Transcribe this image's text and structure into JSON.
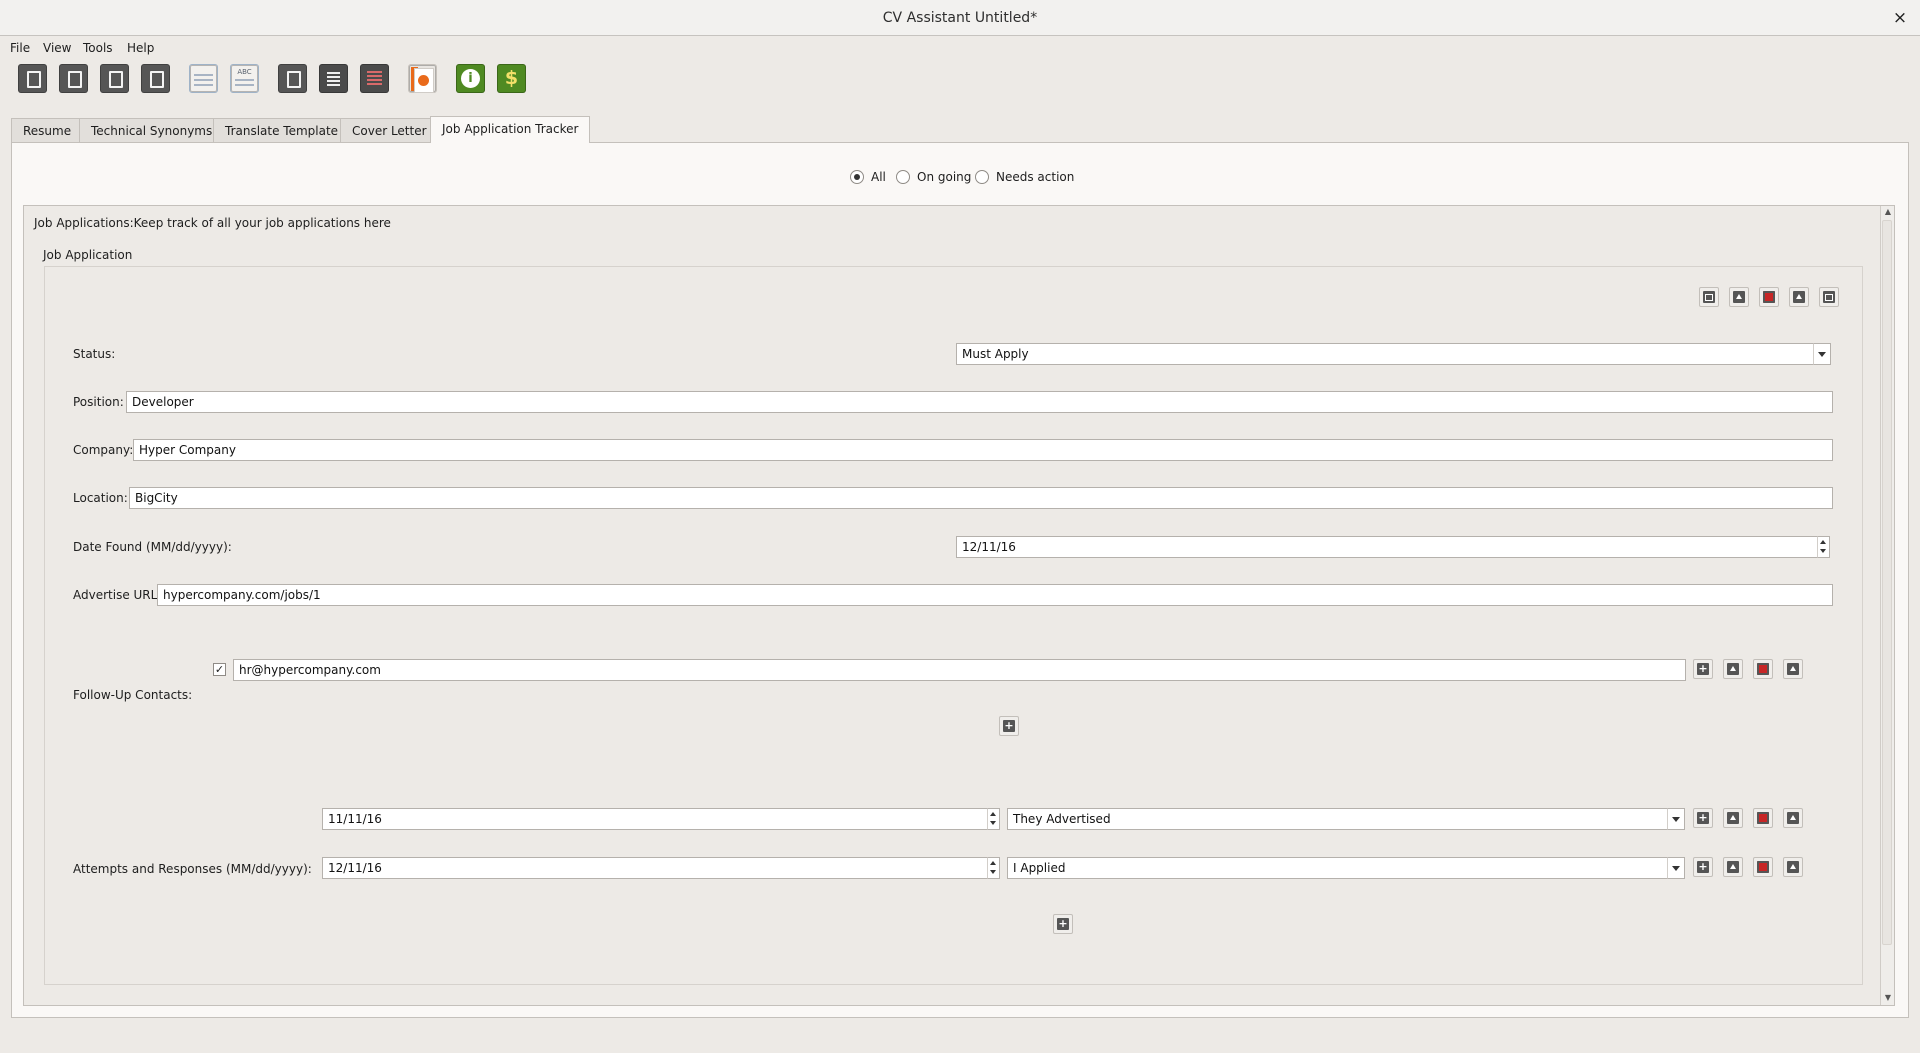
{
  "window": {
    "title": "CV Assistant Untitled*",
    "close_glyph": "×"
  },
  "menu": [
    "File",
    "View",
    "Tools",
    "Help"
  ],
  "toolbar": {
    "buttons": [
      "new-document-icon",
      "copy-document-icon",
      "open-document-icon",
      "save-document-icon",
      "resume-template-icon",
      "spellcheck-icon",
      "export-icon",
      "list-icon",
      "list-red-icon",
      "presentation-icon",
      "info-icon",
      "money-icon"
    ],
    "spell_label": "ABC",
    "info_glyph": "i",
    "money_glyph": "$"
  },
  "tabs": [
    "Resume",
    "Technical Synonyms",
    "Translate Template",
    "Cover Letter",
    "Job Application Tracker"
  ],
  "active_tab": "Job Application Tracker",
  "filter": {
    "options": [
      "All",
      "On going",
      "Needs action"
    ],
    "selected": "All"
  },
  "section": {
    "heading": "Job Applications:Keep track of all your job applications here",
    "group_title": "Job Application"
  },
  "form": {
    "status_label": "Status:",
    "status_value": "Must Apply",
    "position_label": "Position:",
    "position_value": "Developer",
    "company_label": "Company:",
    "company_value": "Hyper Company",
    "location_label": "Location:",
    "location_value": "BigCity",
    "date_found_label": "Date Found (MM/dd/yyyy):",
    "date_found_value": "12/11/16",
    "url_label": "Advertise URL:",
    "url_value": "hypercompany.com/jobs/1",
    "contacts_label": "Follow-Up Contacts:",
    "contacts": [
      {
        "checked": true,
        "value": "hr@hypercompany.com"
      }
    ],
    "attempts_label": "Attempts and Responses (MM/dd/yyyy):",
    "attempts": [
      {
        "date": "11/11/16",
        "response": "They Advertised"
      },
      {
        "date": "12/11/16",
        "response": "I Applied"
      }
    ],
    "check_glyph": "✓",
    "add_glyph": "+"
  }
}
